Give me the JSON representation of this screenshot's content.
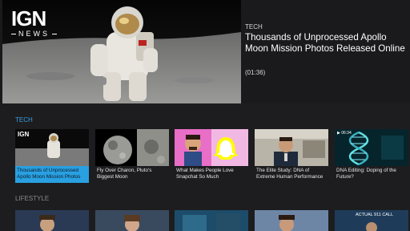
{
  "logo": {
    "brand": "IGN",
    "sub": "NEWS"
  },
  "hero": {
    "category": "TECH",
    "title": "Thousands of Unprocessed Apollo Moon Mission Photos Released Online",
    "duration": "(01:36)"
  },
  "sections": {
    "tech": "TECH",
    "lifestyle": "LIFESTYLE"
  },
  "tech_cards": [
    {
      "title": "Thousands of Unprocessed Apollo Moon Mission Photos",
      "selected": true
    },
    {
      "title": "Fly Over Charon, Pluto's Biggest Moon",
      "selected": false
    },
    {
      "title": "What Makes People Love Snapchat So Much",
      "selected": false
    },
    {
      "title": "The Elite Study: DNA of Extreme Human Performance",
      "selected": false
    },
    {
      "title": "DNA Editing: Doping of the Future?",
      "selected": false
    }
  ],
  "thumb_overlays": {
    "ign_mini": "IGN",
    "dna_time": "▶ 06:34",
    "call_text": "ACTUAL 911 CALL"
  },
  "colors": {
    "accent": "#29a0e2",
    "background": "#1d1d1f",
    "tech_label": "#3a9ee6"
  }
}
